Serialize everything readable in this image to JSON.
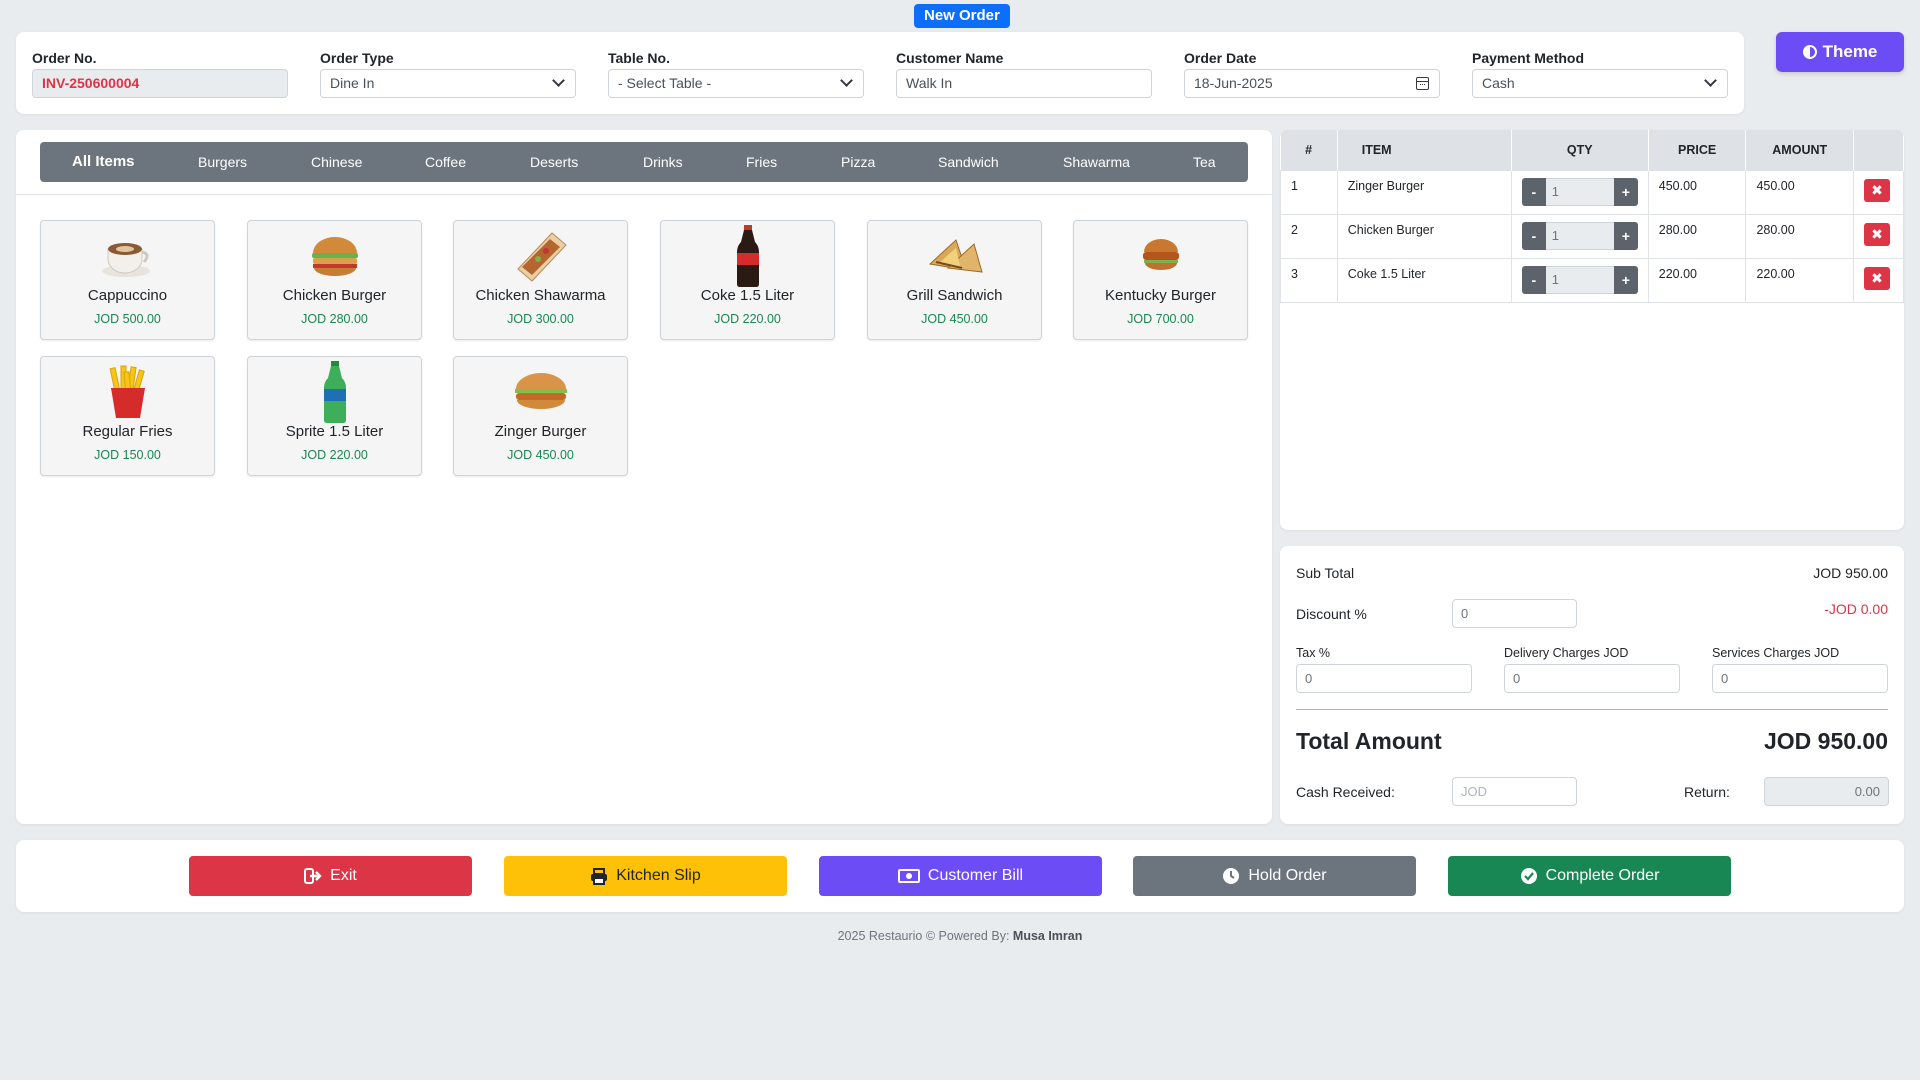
{
  "header": {
    "badge": "New Order",
    "theme_label": "Theme"
  },
  "form": {
    "order_no": {
      "label": "Order No.",
      "value": "INV-250600004"
    },
    "order_type": {
      "label": "Order Type",
      "value": "Dine In"
    },
    "table_no": {
      "label": "Table No.",
      "value": "- Select Table -"
    },
    "customer_name": {
      "label": "Customer Name",
      "value": "Walk In"
    },
    "order_date": {
      "label": "Order Date",
      "value": "18-Jun-2025"
    },
    "payment_method": {
      "label": "Payment Method",
      "value": "Cash"
    }
  },
  "categories": [
    "All Items",
    "Burgers",
    "Chinese",
    "Coffee",
    "Deserts",
    "Drinks",
    "Fries",
    "Pizza",
    "Sandwich",
    "Shawarma",
    "Tea"
  ],
  "items": [
    {
      "name": "Cappuccino",
      "price": "JOD 500.00",
      "icon": "coffee-cup-icon"
    },
    {
      "name": "Chicken Burger",
      "price": "JOD 280.00",
      "icon": "burger-icon"
    },
    {
      "name": "Chicken Shawarma",
      "price": "JOD 300.00",
      "icon": "wrap-icon"
    },
    {
      "name": "Coke 1.5 Liter",
      "price": "JOD 220.00",
      "icon": "cola-bottle-icon"
    },
    {
      "name": "Grill Sandwich",
      "price": "JOD 450.00",
      "icon": "sandwich-icon"
    },
    {
      "name": "Kentucky Burger",
      "price": "JOD 700.00",
      "icon": "burger-icon"
    },
    {
      "name": "Regular Fries",
      "price": "JOD 150.00",
      "icon": "fries-icon"
    },
    {
      "name": "Sprite 1.5 Liter",
      "price": "JOD 220.00",
      "icon": "soda-bottle-icon"
    },
    {
      "name": "Zinger Burger",
      "price": "JOD 450.00",
      "icon": "burger-icon"
    }
  ],
  "order_table": {
    "headers": {
      "num": "#",
      "item": "ITEM",
      "qty": "QTY",
      "price": "PRICE",
      "amount": "AMOUNT"
    },
    "rows": [
      {
        "num": "1",
        "item": "Zinger Burger",
        "qty": "1",
        "price": "450.00",
        "amount": "450.00"
      },
      {
        "num": "2",
        "item": "Chicken Burger",
        "qty": "1",
        "price": "280.00",
        "amount": "280.00"
      },
      {
        "num": "3",
        "item": "Coke 1.5 Liter",
        "qty": "1",
        "price": "220.00",
        "amount": "220.00"
      }
    ],
    "minus": "-",
    "plus": "+",
    "remove": "✖"
  },
  "totals": {
    "sub_total_label": "Sub Total",
    "sub_total_value": "JOD 950.00",
    "discount_label": "Discount %",
    "discount_input": "0",
    "discount_value": "-JOD 0.00",
    "tax_label": "Tax %",
    "tax_input": "0",
    "delivery_label": "Delivery Charges JOD",
    "delivery_input": "0",
    "services_label": "Services Charges JOD",
    "services_input": "0",
    "total_label": "Total Amount",
    "total_value": "JOD 950.00",
    "cash_label": "Cash Received:",
    "cash_placeholder": "JOD",
    "return_label": "Return:",
    "return_value": "0.00"
  },
  "actions": {
    "exit": "Exit",
    "kitchen_slip": "Kitchen Slip",
    "customer_bill": "Customer Bill",
    "hold_order": "Hold Order",
    "complete_order": "Complete Order"
  },
  "footer": {
    "text": "2025 Restaurio © Powered By:",
    "author": "Musa Imran"
  },
  "colors": {
    "accent": "#6c4cf5",
    "danger": "#dc3545",
    "warning": "#ffc107",
    "secondary": "#6c757d",
    "success": "#198754",
    "primary": "#0d6efd"
  }
}
